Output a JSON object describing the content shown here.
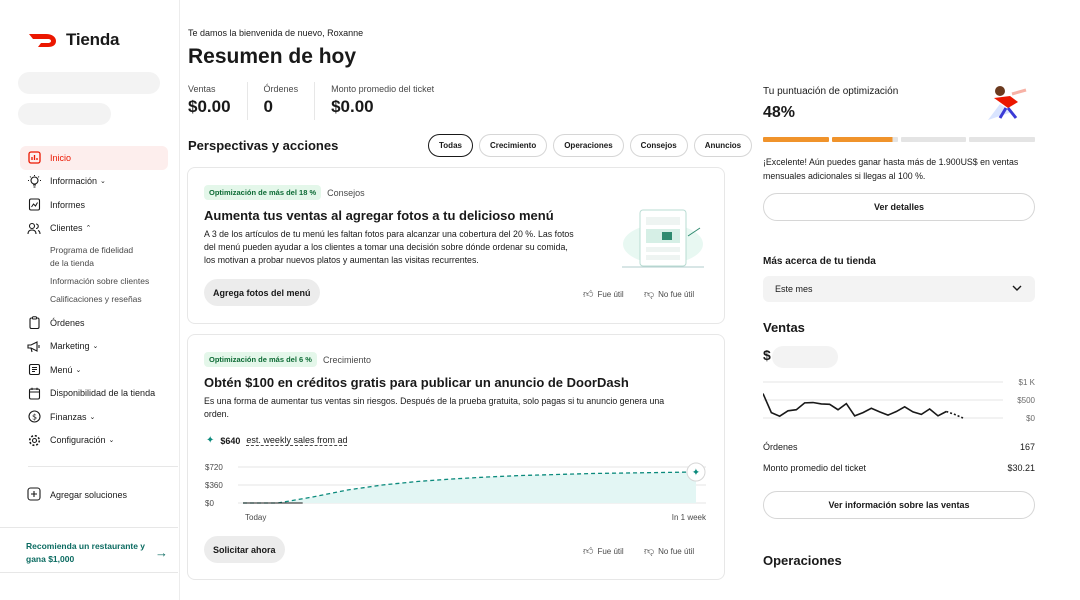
{
  "brand": {
    "name": "Tienda",
    "color": "#eb1700"
  },
  "nav": {
    "items": [
      {
        "label": "Inicio",
        "icon": "chart-bar-icon",
        "active": true
      },
      {
        "label": "Información",
        "icon": "lightbulb-icon",
        "chevron": "down"
      },
      {
        "label": "Informes",
        "icon": "report-icon"
      },
      {
        "label": "Clientes",
        "icon": "users-icon",
        "chevron": "up"
      }
    ],
    "clientes_sub": [
      "Programa de fidelidad de la tienda",
      "Información sobre clientes",
      "Calificaciones y reseñas"
    ],
    "items2": [
      {
        "label": "Órdenes",
        "icon": "clipboard-icon"
      },
      {
        "label": "Marketing",
        "icon": "megaphone-icon",
        "chevron": "down"
      },
      {
        "label": "Menú",
        "icon": "menu-book-icon",
        "chevron": "down"
      },
      {
        "label": "Disponibilidad de la tienda",
        "icon": "calendar-icon"
      },
      {
        "label": "Finanzas",
        "icon": "dollar-circle-icon",
        "chevron": "down"
      },
      {
        "label": "Configuración",
        "icon": "gear-icon",
        "chevron": "down"
      }
    ],
    "add_solutions": "Agregar soluciones",
    "refer_text": "Recomienda un restaurante y gana $1,000"
  },
  "header": {
    "welcome": "Te damos la bienvenida de nuevo, Roxanne",
    "title": "Resumen de hoy"
  },
  "stats": [
    {
      "label": "Ventas",
      "value": "$0.00"
    },
    {
      "label": "Órdenes",
      "value": "0"
    },
    {
      "label": "Monto promedio del ticket",
      "value": "$0.00"
    }
  ],
  "insights": {
    "title": "Perspectivas y acciones",
    "filters": [
      "Todas",
      "Crecimiento",
      "Operaciones",
      "Consejos",
      "Anuncios"
    ],
    "selected_filter": "Todas",
    "feedback_yes": "Fue útil",
    "feedback_no": "No fue útil",
    "cards": [
      {
        "badge": "Optimización de más del 18 %",
        "category": "Consejos",
        "title": "Aumenta tus ventas al agregar fotos a tu delicioso menú",
        "body_lines": [
          "A 3 de los artículos de tu menú les faltan fotos para alcanzar una cobertura del 20 %. Las fotos",
          "del menú pueden ayudar a los clientes a tomar una decisión sobre dónde ordenar su comida,",
          "los motivan a probar nuevos platos y aumentan las visitas recurrentes."
        ],
        "button": "Agrega fotos del menú"
      },
      {
        "badge": "Optimización de más del 6 %",
        "category": "Crecimiento",
        "title": "Obtén $100 en créditos gratis para publicar un anuncio de DoorDash",
        "body_lines": [
          "Es una forma de aumentar tus ventas sin riesgos. Después de la prueba gratuita, solo pagas si tu anuncio genera una",
          "orden."
        ],
        "est_value": "$640",
        "est_label": "est. weekly sales from ad",
        "chart_y_ticks": [
          "$720",
          "$360",
          "$0"
        ],
        "chart_x_start": "Today",
        "chart_x_end": "In 1 week",
        "button": "Solicitar ahora"
      }
    ]
  },
  "chart_data": [
    {
      "type": "area",
      "x": [
        "Today",
        "In 1 week"
      ],
      "ylim": [
        0,
        720
      ],
      "ytick_labels": [
        "$0",
        "$360",
        "$720"
      ],
      "series": [
        {
          "values": [
            0,
            0,
            120,
            260,
            360,
            430,
            480,
            520,
            550,
            570,
            590,
            600,
            610,
            620
          ],
          "color": "#0b8a7c"
        }
      ],
      "grid": true
    },
    {
      "type": "line",
      "ylim": [
        0,
        1000
      ],
      "ytick_labels": [
        "$0",
        "$500",
        "$1 K"
      ],
      "series": [
        {
          "values": [
            680,
            150,
            50,
            200,
            230,
            420,
            430,
            390,
            380,
            230,
            400,
            60,
            150,
            270,
            170,
            80,
            180,
            310,
            170,
            100,
            250,
            60,
            180,
            100,
            0
          ],
          "color": "#191919"
        }
      ],
      "grid": true
    }
  ],
  "optimization": {
    "title": "Tu puntuación de optimización",
    "value": "48%",
    "text": "¡Excelente! Aún puedes ganar hasta más de 1.900US$ en ventas mensuales adicionales si llegas al 100 %.",
    "details_button": "Ver detalles",
    "progress": 0.48,
    "fill_color": "#f0932b",
    "empty_color": "#e4e4e4"
  },
  "store": {
    "title": "Más acerca de tu tienda",
    "period": "Este mes",
    "sales_title": "Ventas",
    "sales_prefix": "$",
    "orders_label": "Órdenes",
    "orders_value": "167",
    "avg_label": "Monto promedio del ticket",
    "avg_value": "$30.21",
    "sales_button": "Ver información sobre las ventas",
    "ops_title": "Operaciones"
  }
}
